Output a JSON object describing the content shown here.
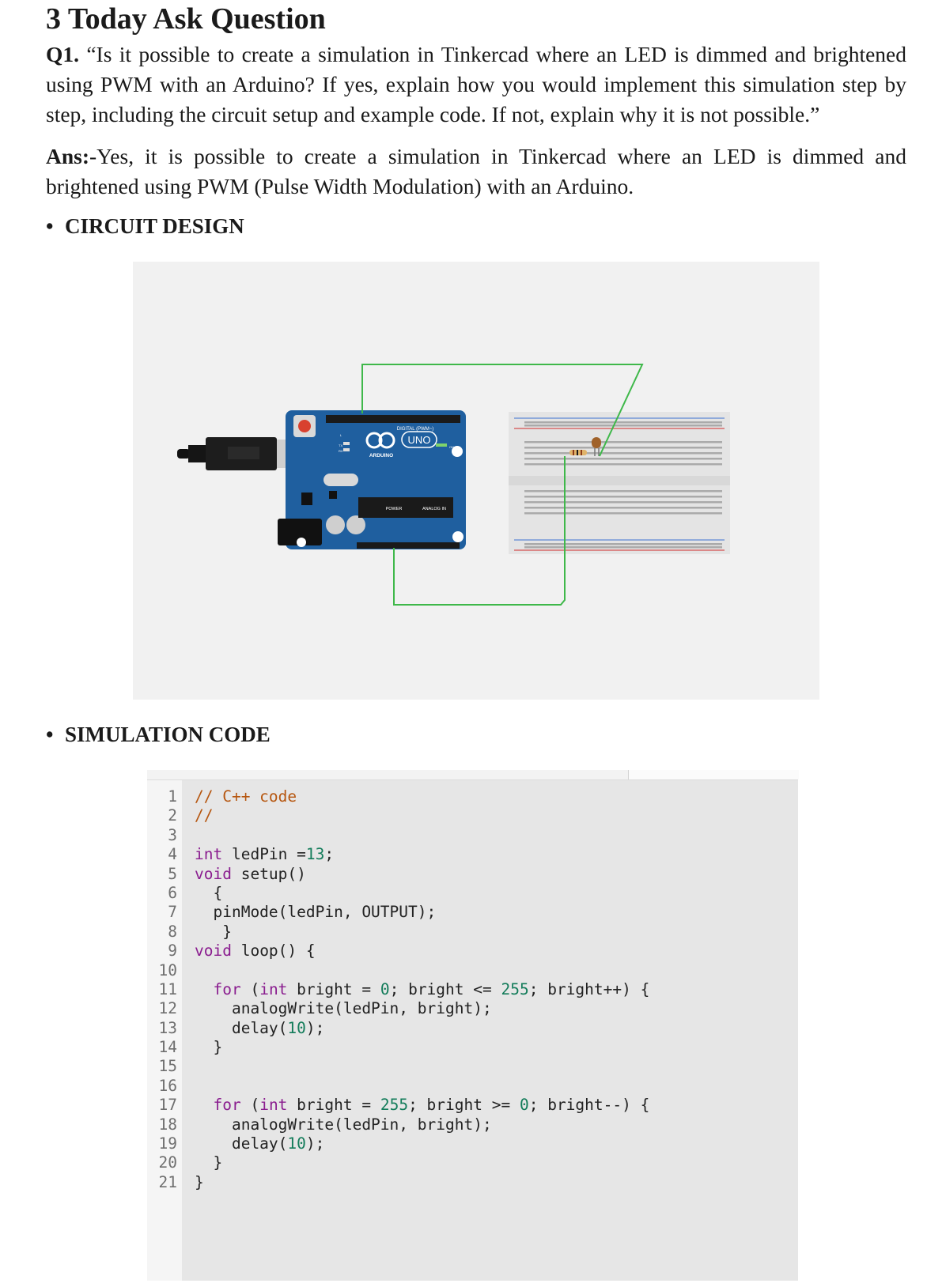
{
  "section": {
    "title": "3 Today Ask Question"
  },
  "question": {
    "label": "Q1.",
    "text": " “Is it possible to create a simulation in Tinkercad where an LED is dimmed and brightened using PWM with an Arduino? If yes, explain how you would implement this simulation step by step, including the circuit setup and example code. If not, explain why it is not possible.”"
  },
  "answer": {
    "label": "Ans:",
    "text": "-Yes, it is possible to create a simulation in Tinkercad where an LED is dimmed and brightened using PWM (Pulse Width Modulation) with an Arduino."
  },
  "bullets": {
    "circuit_design": "CIRCUIT DESIGN",
    "simulation_code": "SIMULATION CODE"
  },
  "circuit": {
    "board_label_digital": "DIGITAL (PWM~)",
    "board_label_uno": "UNO",
    "board_label_arduino": "ARDUINO",
    "board_label_power": "POWER",
    "board_label_analog": "ANALOG IN",
    "board_label_on": "ON",
    "board_label_tx": "TX",
    "board_label_rx": "RX",
    "board_label_l": "L",
    "colors": {
      "board": "#1f5f9f",
      "wire": "#3fb84a",
      "breadboard": "#e4e4e4",
      "background": "#f1f1f1"
    }
  },
  "code": {
    "line_numbers": [
      "1",
      "2",
      "3",
      "4",
      "5",
      "6",
      "7",
      "8",
      "9",
      "10",
      "11",
      "12",
      "13",
      "14",
      "15",
      "16",
      "17",
      "18",
      "19",
      "20",
      "21"
    ],
    "lines": [
      [
        {
          "t": "// C++ code",
          "c": "comment"
        }
      ],
      [
        {
          "t": "//",
          "c": "comment"
        }
      ],
      [],
      [
        {
          "t": "int",
          "c": "kw"
        },
        {
          "t": " ledPin =",
          "c": ""
        },
        {
          "t": "13",
          "c": "num"
        },
        {
          "t": ";",
          "c": ""
        }
      ],
      [
        {
          "t": "void",
          "c": "kw"
        },
        {
          "t": " setup()",
          "c": ""
        }
      ],
      [
        {
          "t": "  {",
          "c": ""
        }
      ],
      [
        {
          "t": "  pinMode(ledPin, OUTPUT);",
          "c": ""
        }
      ],
      [
        {
          "t": "   }",
          "c": ""
        }
      ],
      [
        {
          "t": "void",
          "c": "kw"
        },
        {
          "t": " loop() {",
          "c": ""
        }
      ],
      [],
      [
        {
          "t": "  ",
          "c": ""
        },
        {
          "t": "for",
          "c": "kw"
        },
        {
          "t": " (",
          "c": ""
        },
        {
          "t": "int",
          "c": "kw"
        },
        {
          "t": " bright = ",
          "c": ""
        },
        {
          "t": "0",
          "c": "num"
        },
        {
          "t": "; bright <= ",
          "c": ""
        },
        {
          "t": "255",
          "c": "num"
        },
        {
          "t": "; bright++) {",
          "c": ""
        }
      ],
      [
        {
          "t": "    analogWrite(ledPin, bright);",
          "c": ""
        }
      ],
      [
        {
          "t": "    delay(",
          "c": ""
        },
        {
          "t": "10",
          "c": "num"
        },
        {
          "t": ");",
          "c": ""
        }
      ],
      [
        {
          "t": "  }",
          "c": ""
        }
      ],
      [],
      [],
      [
        {
          "t": "  ",
          "c": ""
        },
        {
          "t": "for",
          "c": "kw"
        },
        {
          "t": " (",
          "c": ""
        },
        {
          "t": "int",
          "c": "kw"
        },
        {
          "t": " bright = ",
          "c": ""
        },
        {
          "t": "255",
          "c": "num"
        },
        {
          "t": "; bright >= ",
          "c": ""
        },
        {
          "t": "0",
          "c": "num"
        },
        {
          "t": "; bright--) {",
          "c": ""
        }
      ],
      [
        {
          "t": "    analogWrite(ledPin, bright);",
          "c": ""
        }
      ],
      [
        {
          "t": "    delay(",
          "c": ""
        },
        {
          "t": "10",
          "c": "num"
        },
        {
          "t": ");",
          "c": ""
        }
      ],
      [
        {
          "t": "  }",
          "c": ""
        }
      ],
      [
        {
          "t": "}",
          "c": ""
        }
      ]
    ]
  }
}
